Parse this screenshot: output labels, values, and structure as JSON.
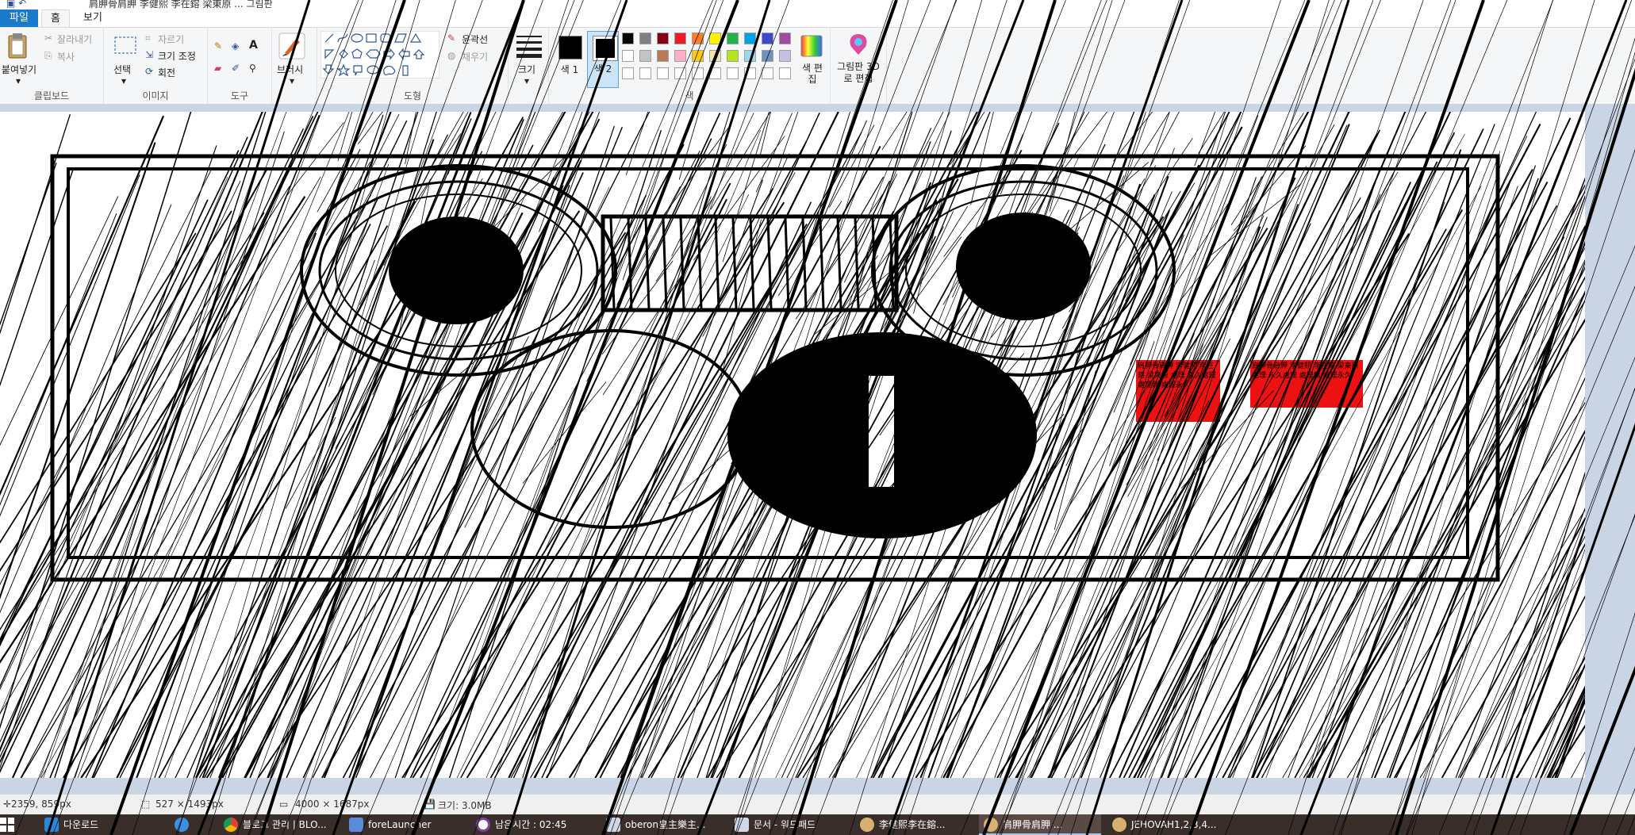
{
  "window": {
    "title": "肩胛骨肩胛 李健熙 李在鎔 梁東原 ... 그림판"
  },
  "tabs": {
    "file": "파일",
    "home": "홈",
    "view": "보기"
  },
  "clipboard": {
    "paste": "붙여넣기",
    "cut": "잘라내기",
    "copy": "복사",
    "group": "클립보드"
  },
  "image": {
    "select": "선택",
    "crop": "자르기",
    "resize": "크기 조정",
    "rotate": "회전",
    "group": "이미지"
  },
  "tools": {
    "group": "도구"
  },
  "brushes": {
    "label": "브러시"
  },
  "shapes": {
    "outline": "윤곽선",
    "fill": "채우기",
    "group": "도형"
  },
  "size": {
    "label": "크기"
  },
  "colors": {
    "color1": "색 1",
    "color2": "색 2",
    "edit": "색 편집",
    "group": "색",
    "palette_row1": [
      "#000000",
      "#7f7f7f",
      "#880015",
      "#ed1c24",
      "#ff7f27",
      "#fff200",
      "#22b14c",
      "#00a2e8",
      "#3f48cc",
      "#a349a4"
    ],
    "palette_row2": [
      "#ffffff",
      "#c3c3c3",
      "#b97a57",
      "#ffaec9",
      "#ffc90e",
      "#efe4b0",
      "#b5e61d",
      "#99d9ea",
      "#7092be",
      "#c8bfe7"
    ]
  },
  "paint3d": {
    "label": "그림판 3D로 편집"
  },
  "status": {
    "cursor": "2359, 859px",
    "selection": "527 × 1493px",
    "dimensions": "4000 × 1687px",
    "filesize": "크기: 3.0MB"
  },
  "taskbar": {
    "items": [
      "다운로드",
      "블로그 관리 | BLO...",
      "foreLauncher",
      "남은시간 : 02:45",
      "oberon皇主樂主...",
      "문서 - 워드패드",
      "李健熙李在鎔...",
      "肩胛骨肩胛 ...",
      "JEHOVAH1,2,3,4..."
    ]
  },
  "canvas": {
    "red_text": "肩胛骨肩胛 李健熙 李在鎔 梁東原 處理 永久處理 處理無 處理永久"
  }
}
